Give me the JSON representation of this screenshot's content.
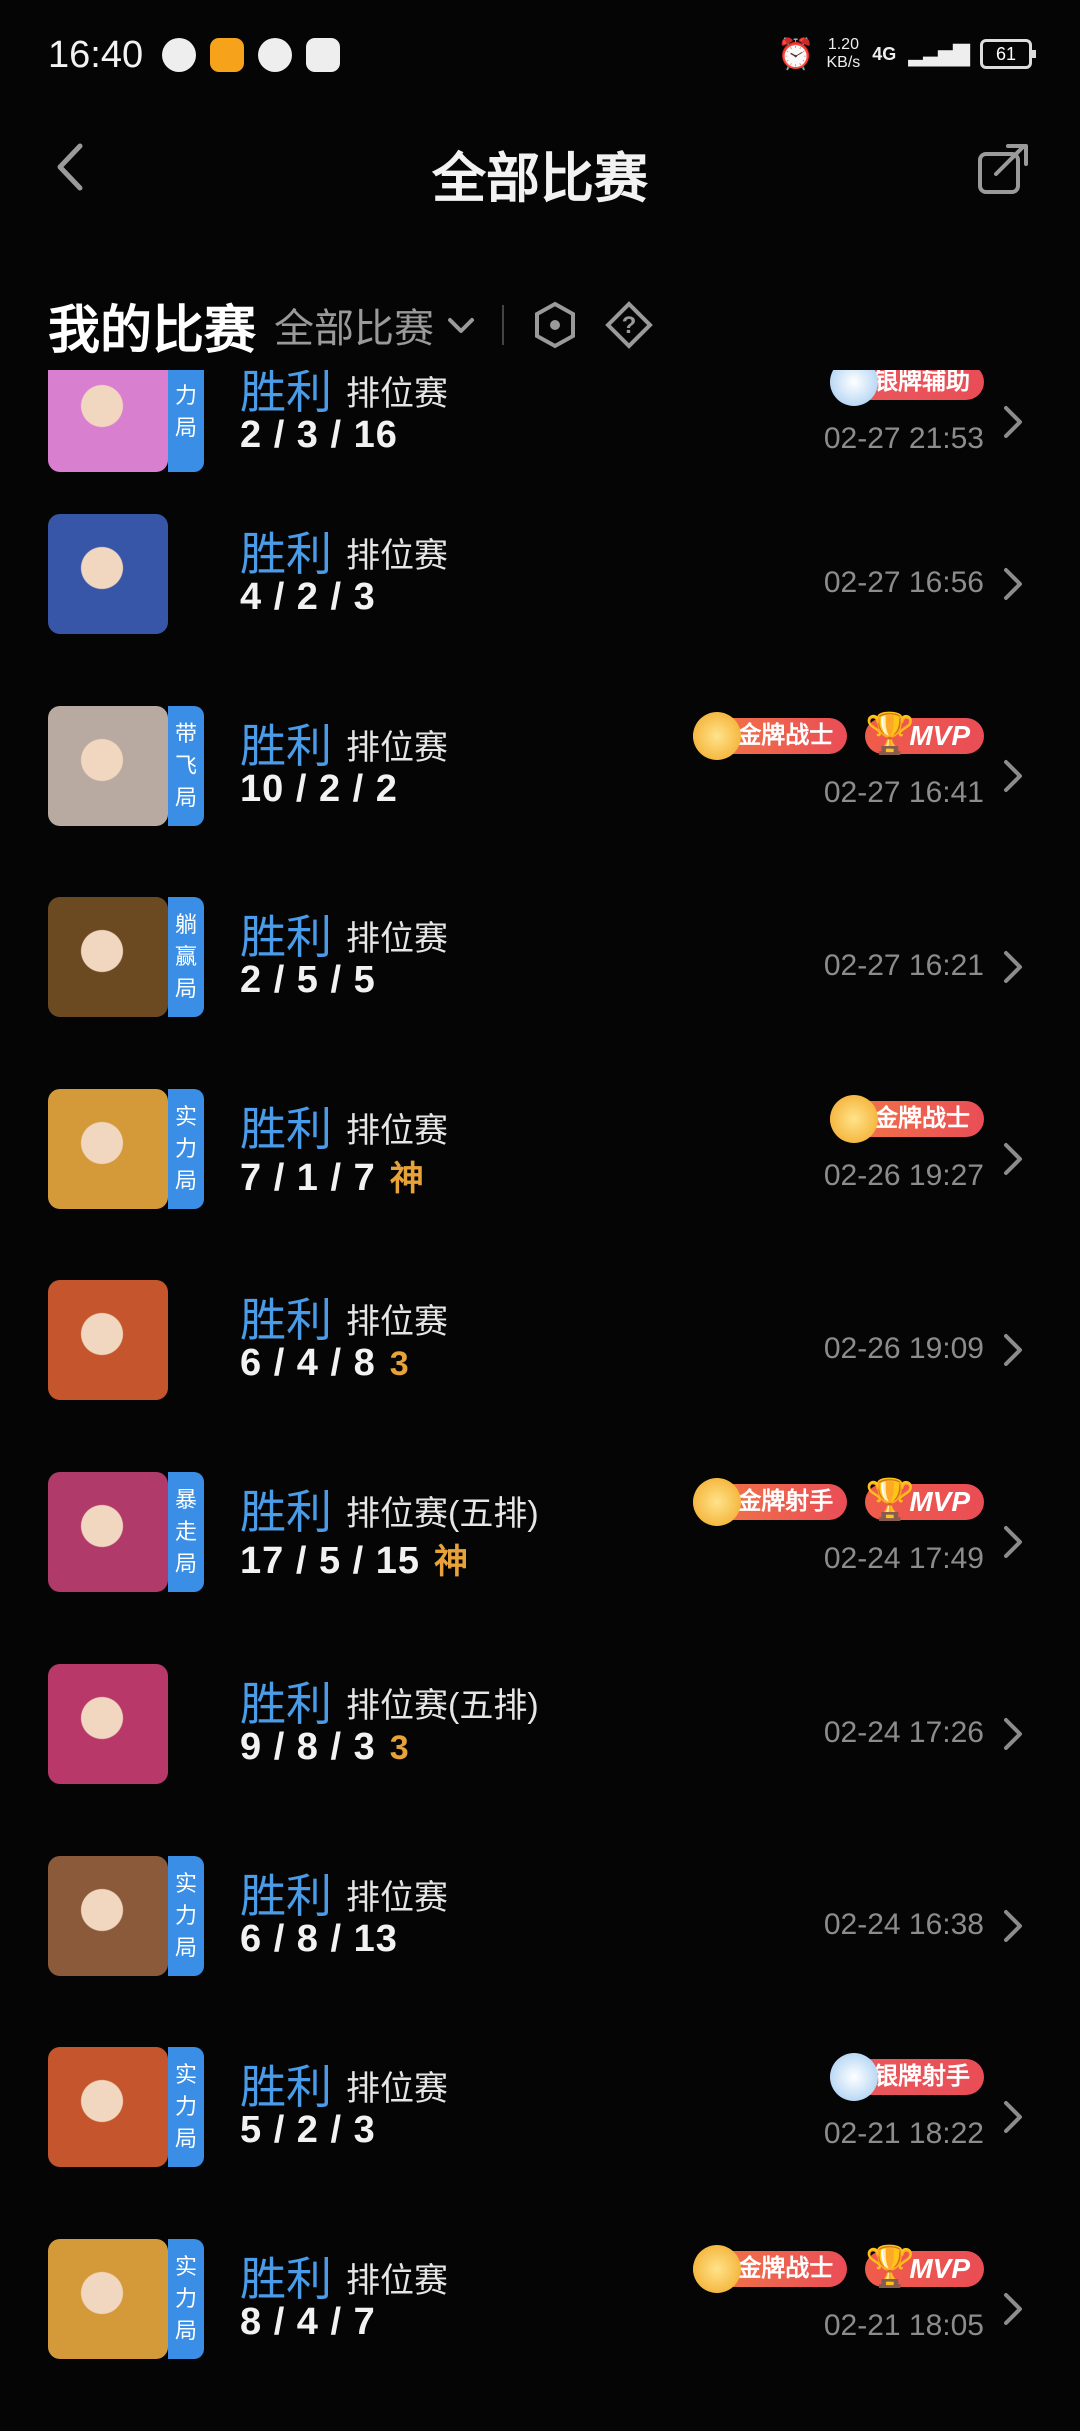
{
  "status_bar": {
    "time": "16:40",
    "net_speed_value": "1.20",
    "net_speed_unit": "KB/s",
    "network": "4G",
    "battery": "61"
  },
  "header": {
    "title": "全部比赛"
  },
  "filter": {
    "my_matches": "我的比赛",
    "all_matches": "全部比赛"
  },
  "colors": {
    "accent_blue": "#4a9be8",
    "tag_blue": "#3a8ee6",
    "honor_gold": "#e8a23a",
    "badge_red": "#e94d56"
  },
  "matches": [
    {
      "result": "胜利",
      "mode": "排位赛",
      "kda": "2 / 3 / 16",
      "honor": "",
      "time": "02-27 21:53",
      "tag": [
        "力",
        "局"
      ],
      "badges": [
        "银牌辅助"
      ],
      "avatar_color": "#d97fd0"
    },
    {
      "result": "胜利",
      "mode": "排位赛",
      "kda": "4 / 2 / 3",
      "honor": "",
      "time": "02-27 16:56",
      "tag": [],
      "badges": [],
      "avatar_color": "#3856a8"
    },
    {
      "result": "胜利",
      "mode": "排位赛",
      "kda": "10 / 2 / 2",
      "honor": "",
      "time": "02-27 16:41",
      "tag": [
        "带",
        "飞",
        "局"
      ],
      "badges": [
        "金牌战士",
        "MVP"
      ],
      "avatar_color": "#b8aaa0"
    },
    {
      "result": "胜利",
      "mode": "排位赛",
      "kda": "2 / 5 / 5",
      "honor": "",
      "time": "02-27 16:21",
      "tag": [
        "躺",
        "赢",
        "局"
      ],
      "badges": [],
      "avatar_color": "#6b4a22"
    },
    {
      "result": "胜利",
      "mode": "排位赛",
      "kda": "7 / 1 / 7",
      "honor": "神",
      "time": "02-26 19:27",
      "tag": [
        "实",
        "力",
        "局"
      ],
      "badges": [
        "金牌战士"
      ],
      "avatar_color": "#d49a3a"
    },
    {
      "result": "胜利",
      "mode": "排位赛",
      "kda": "6 / 4 / 8",
      "honor": "3",
      "time": "02-26 19:09",
      "tag": [],
      "badges": [],
      "avatar_color": "#c4552c"
    },
    {
      "result": "胜利",
      "mode": "排位赛(五排)",
      "kda": "17 / 5 / 15",
      "honor": "神",
      "time": "02-24 17:49",
      "tag": [
        "暴",
        "走",
        "局"
      ],
      "badges": [
        "金牌射手",
        "MVP"
      ],
      "avatar_color": "#b03a6a"
    },
    {
      "result": "胜利",
      "mode": "排位赛(五排)",
      "kda": "9 / 8 / 3",
      "honor": "3",
      "time": "02-24 17:26",
      "tag": [],
      "badges": [],
      "avatar_color": "#b8386a"
    },
    {
      "result": "胜利",
      "mode": "排位赛",
      "kda": "6 / 8 / 13",
      "honor": "",
      "time": "02-24 16:38",
      "tag": [
        "实",
        "力",
        "局"
      ],
      "badges": [],
      "avatar_color": "#8a5a3a"
    },
    {
      "result": "胜利",
      "mode": "排位赛",
      "kda": "5 / 2 / 3",
      "honor": "",
      "time": "02-21 18:22",
      "tag": [
        "实",
        "力",
        "局"
      ],
      "badges": [
        "银牌射手"
      ],
      "avatar_color": "#c4552c"
    },
    {
      "result": "胜利",
      "mode": "排位赛",
      "kda": "8 / 4 / 7",
      "honor": "",
      "time": "02-21 18:05",
      "tag": [
        "实",
        "力",
        "局"
      ],
      "badges": [
        "金牌战士",
        "MVP"
      ],
      "avatar_color": "#d49a3a"
    }
  ]
}
